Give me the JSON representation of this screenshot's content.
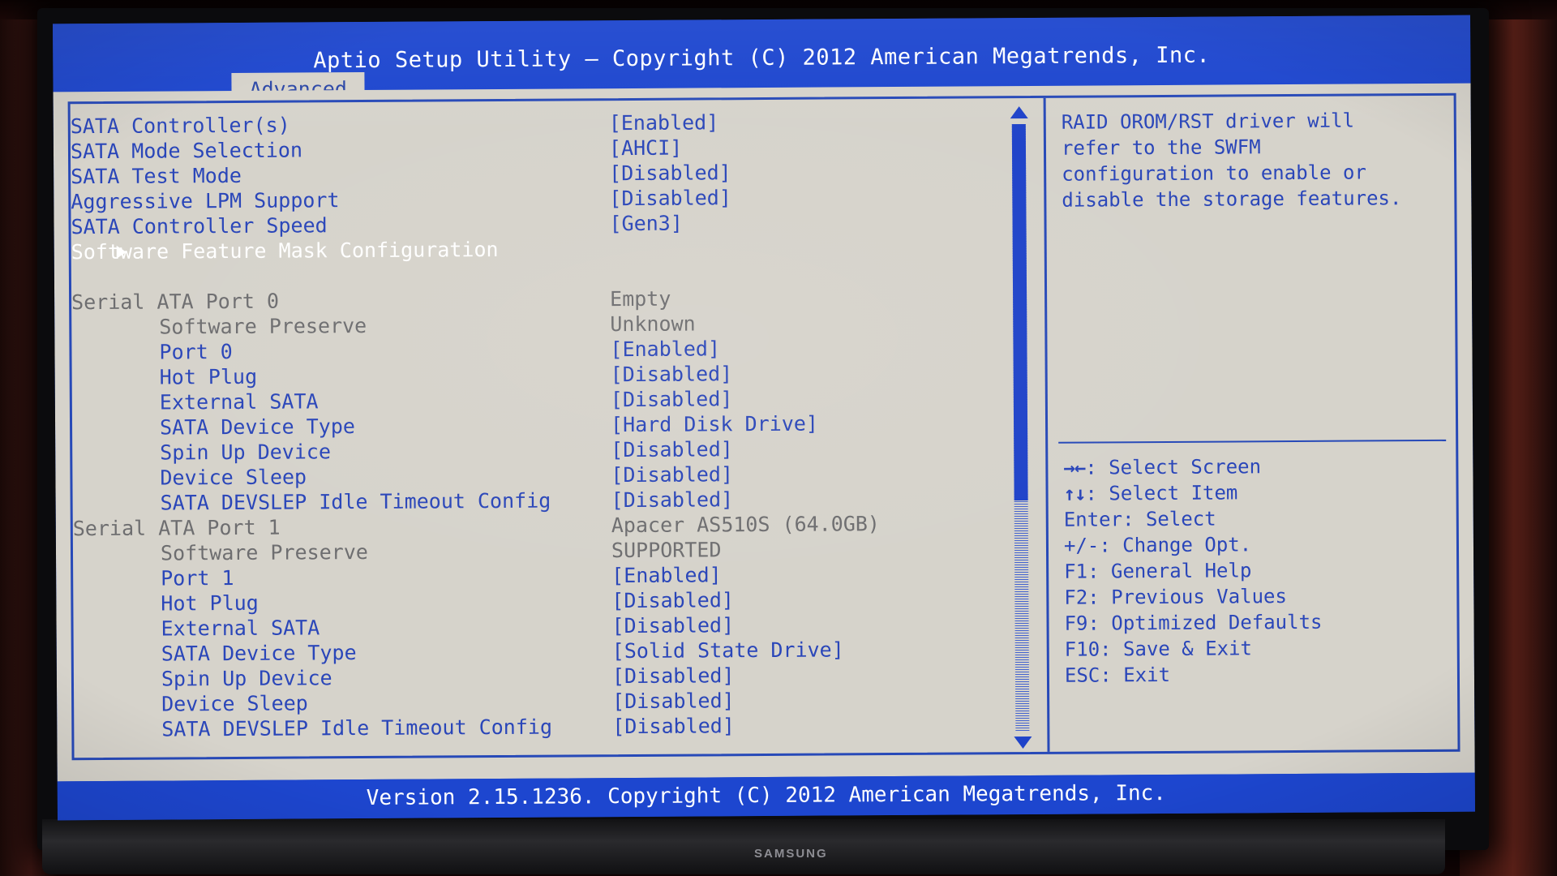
{
  "window": {
    "app_title": "Aptio Setup Utility – Copyright (C) 2012 American Megatrends, Inc.",
    "footer": "Version 2.15.1236. Copyright (C) 2012 American Megatrends, Inc.",
    "monitor_brand": "SAMSUNG"
  },
  "tabs": [
    {
      "label": "Advanced",
      "active": true
    }
  ],
  "settings": [
    {
      "label": "SATA Controller(s)",
      "value": "[Enabled]",
      "style": "normal",
      "indent": 0,
      "arrow": false
    },
    {
      "label": "SATA Mode Selection",
      "value": "[AHCI]",
      "style": "normal",
      "indent": 0,
      "arrow": false
    },
    {
      "label": "SATA Test Mode",
      "value": "[Disabled]",
      "style": "normal",
      "indent": 0,
      "arrow": false
    },
    {
      "label": "Aggressive LPM Support",
      "value": "[Disabled]",
      "style": "normal",
      "indent": 0,
      "arrow": false
    },
    {
      "label": "SATA Controller Speed",
      "value": "[Gen3]",
      "style": "normal",
      "indent": 0,
      "arrow": false
    },
    {
      "label": "Software Feature Mask Configuration",
      "value": "",
      "style": "selected",
      "indent": 0,
      "arrow": true
    },
    {
      "label": "",
      "value": "",
      "style": "spacer",
      "indent": 0,
      "arrow": false
    },
    {
      "label": "Serial ATA Port 0",
      "value": "Empty",
      "style": "dim",
      "indent": 0,
      "arrow": false
    },
    {
      "label": "Software Preserve",
      "value": "Unknown",
      "style": "dim",
      "indent": 1,
      "arrow": false
    },
    {
      "label": "Port 0",
      "value": "[Enabled]",
      "style": "normal",
      "indent": 1,
      "arrow": false
    },
    {
      "label": "Hot Plug",
      "value": "[Disabled]",
      "style": "normal",
      "indent": 1,
      "arrow": false
    },
    {
      "label": "External SATA",
      "value": "[Disabled]",
      "style": "normal",
      "indent": 1,
      "arrow": false
    },
    {
      "label": "SATA Device Type",
      "value": "[Hard Disk Drive]",
      "style": "normal",
      "indent": 1,
      "arrow": false
    },
    {
      "label": "Spin Up Device",
      "value": "[Disabled]",
      "style": "normal",
      "indent": 1,
      "arrow": false
    },
    {
      "label": "Device Sleep",
      "value": "[Disabled]",
      "style": "normal",
      "indent": 1,
      "arrow": false
    },
    {
      "label": "SATA DEVSLEP Idle Timeout Config",
      "value": "[Disabled]",
      "style": "normal",
      "indent": 1,
      "arrow": false
    },
    {
      "label": "Serial ATA Port 1",
      "value": "Apacer AS510S  (64.0GB)",
      "style": "dim",
      "indent": 0,
      "arrow": false
    },
    {
      "label": "Software Preserve",
      "value": "SUPPORTED",
      "style": "dim",
      "indent": 1,
      "arrow": false
    },
    {
      "label": "Port 1",
      "value": "[Enabled]",
      "style": "normal",
      "indent": 1,
      "arrow": false
    },
    {
      "label": "Hot Plug",
      "value": "[Disabled]",
      "style": "normal",
      "indent": 1,
      "arrow": false
    },
    {
      "label": "External SATA",
      "value": "[Disabled]",
      "style": "normal",
      "indent": 1,
      "arrow": false
    },
    {
      "label": "SATA Device Type",
      "value": "[Solid State Drive]",
      "style": "normal",
      "indent": 1,
      "arrow": false
    },
    {
      "label": "Spin Up Device",
      "value": "[Disabled]",
      "style": "normal",
      "indent": 1,
      "arrow": false
    },
    {
      "label": "Device Sleep",
      "value": "[Disabled]",
      "style": "normal",
      "indent": 1,
      "arrow": false
    },
    {
      "label": "SATA DEVSLEP Idle Timeout Config",
      "value": "[Disabled]",
      "style": "normal",
      "indent": 1,
      "arrow": false
    }
  ],
  "help": {
    "lines": [
      "RAID OROM/RST driver will",
      "refer to the SWFM",
      "configuration to enable or",
      "disable the storage features."
    ],
    "keys": [
      {
        "glyph": "→←",
        "text": ": Select Screen"
      },
      {
        "glyph": "↑↓",
        "text": ": Select Item"
      },
      {
        "glyph": "",
        "text": "Enter: Select"
      },
      {
        "glyph": "",
        "text": "+/-: Change Opt."
      },
      {
        "glyph": "",
        "text": "F1: General Help"
      },
      {
        "glyph": "",
        "text": "F2: Previous Values"
      },
      {
        "glyph": "",
        "text": "F9: Optimized Defaults"
      },
      {
        "glyph": "",
        "text": "F10: Save & Exit"
      },
      {
        "glyph": "",
        "text": "ESC: Exit"
      }
    ]
  },
  "scrollbar": {
    "up_arrow": "scroll-up-arrow",
    "down_arrow": "scroll-down-arrow",
    "thumb_position_percent": 0,
    "thumb_size_percent": 62
  },
  "colors": {
    "screen_blue": "#1d46cf",
    "panel_bg": "#d6d3cb",
    "text_blue": "#2a46b9",
    "text_dim": "#6e6e70",
    "text_selected": "#ffffff",
    "border_blue": "#2749b8"
  }
}
